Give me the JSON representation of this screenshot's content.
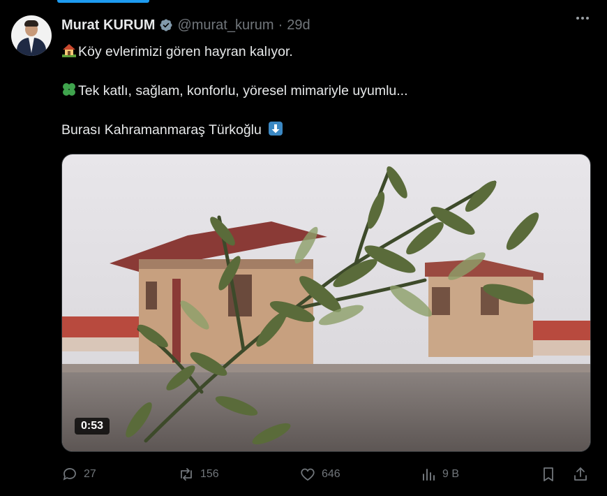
{
  "author": {
    "name": "Murat KURUM",
    "handle": "@murat_kurum",
    "separator": "·",
    "time": "29d"
  },
  "tweet": {
    "line1": "Köy evlerimizi gören hayran kalıyor.",
    "line2": "Tek katlı, sağlam, konforlu, yöresel mimariyle uyumlu...",
    "line3": "Burası Kahramanmaraş Türkoğlu",
    "icons": [
      "house-emoji",
      "clover-emoji",
      "down-arrow-emoji"
    ]
  },
  "video": {
    "duration": "0:53"
  },
  "actions": {
    "replies": "27",
    "reposts": "156",
    "likes": "646",
    "views": "9 B"
  },
  "colors": {
    "accent": "#1d9bf0",
    "muted": "#71767b",
    "text": "#e7e9ea",
    "background": "#000000"
  }
}
